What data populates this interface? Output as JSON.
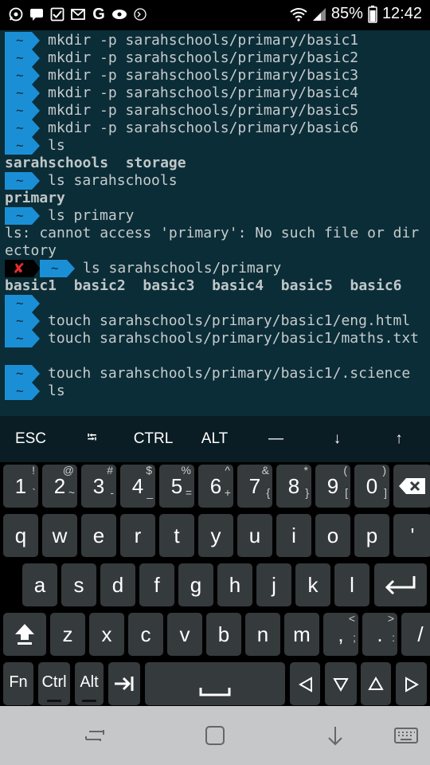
{
  "status_bar": {
    "notification_icons": [
      "whatsapp-icon",
      "message-icon",
      "checkbox-icon",
      "gmail-icon",
      "google-icon",
      "nfc-icon",
      "terminal-icon"
    ],
    "battery": "85%",
    "time": "12:42"
  },
  "terminal": {
    "lines": [
      {
        "prompt": "~",
        "text": "mkdir -p sarahschools/primary/basic1"
      },
      {
        "prompt": "~",
        "text": "mkdir -p sarahschools/primary/basic2"
      },
      {
        "prompt": "~",
        "text": "mkdir -p sarahschools/primary/basic3"
      },
      {
        "prompt": "~",
        "text": "mkdir -p sarahschools/primary/basic4"
      },
      {
        "prompt": "~",
        "text": "mkdir -p sarahschools/primary/basic5"
      },
      {
        "prompt": "~",
        "text": "mkdir -p sarahschools/primary/basic6"
      },
      {
        "prompt": "~",
        "text": "ls"
      },
      {
        "output": "sarahschools  storage",
        "bold": true
      },
      {
        "prompt": "~",
        "text": "ls sarahschools"
      },
      {
        "output": "primary",
        "bold": true
      },
      {
        "prompt": "~",
        "text": "ls primary"
      },
      {
        "output": "ls: cannot access 'primary': No such file or dir"
      },
      {
        "output": "ectory"
      },
      {
        "prompt": "~",
        "error_mark": "✘",
        "text": "ls sarahschools/primary"
      },
      {
        "output": "basic1  basic2  basic3  basic4  basic5  basic6",
        "bold": true
      },
      {
        "prompt": "~",
        "text": ""
      },
      {
        "prompt": "~",
        "text": "touch sarahschools/primary/basic1/eng.html"
      },
      {
        "prompt": "~",
        "text": "touch sarahschools/primary/basic1/maths.txt"
      },
      {
        "output": ""
      },
      {
        "prompt": "~",
        "text": "touch sarahschools/primary/basic1/.science"
      },
      {
        "prompt": "~",
        "text": "ls"
      }
    ]
  },
  "extra_keys": [
    "ESC",
    "⭾",
    "CTRL",
    "ALT",
    "—",
    "↓",
    "↑"
  ],
  "keyboard": {
    "row1": [
      {
        "k": "1",
        "s": "!"
      },
      {
        "k": "2",
        "s": "@"
      },
      {
        "k": "3",
        "s": "#"
      },
      {
        "k": "4",
        "s": "$"
      },
      {
        "k": "5",
        "s": "%"
      },
      {
        "k": "6",
        "s": "^"
      },
      {
        "k": "7",
        "s": "&"
      },
      {
        "k": "8",
        "s": "*"
      },
      {
        "k": "9",
        "s": "("
      },
      {
        "k": "0",
        "s": ")"
      }
    ],
    "row1_sub2": [
      "`",
      "~",
      "-",
      "_",
      "=",
      "+",
      "{",
      "}",
      "[",
      "]"
    ],
    "row2": [
      "q",
      "w",
      "e",
      "r",
      "t",
      "y",
      "u",
      "i",
      "o",
      "p",
      "'"
    ],
    "row3": [
      "a",
      "s",
      "d",
      "f",
      "g",
      "h",
      "j",
      "k",
      "l"
    ],
    "row4": [
      "z",
      "x",
      "c",
      "v",
      "b",
      "n",
      "m",
      ",",
      ".",
      "/"
    ],
    "row4_subs": [
      "",
      "",
      "",
      "",
      "",
      "",
      "",
      "<",
      ">",
      "?"
    ],
    "row4_sub2": [
      "",
      "",
      "",
      "",
      "",
      "",
      "",
      ";",
      ":",
      "\\"
    ],
    "row5": {
      "fn": "Fn",
      "ctrl": "Ctrl",
      "alt": "Alt",
      "tab": "→|",
      "space": "␣",
      "left": "◁",
      "down": "▽",
      "up": "△",
      "right": "▷"
    }
  }
}
